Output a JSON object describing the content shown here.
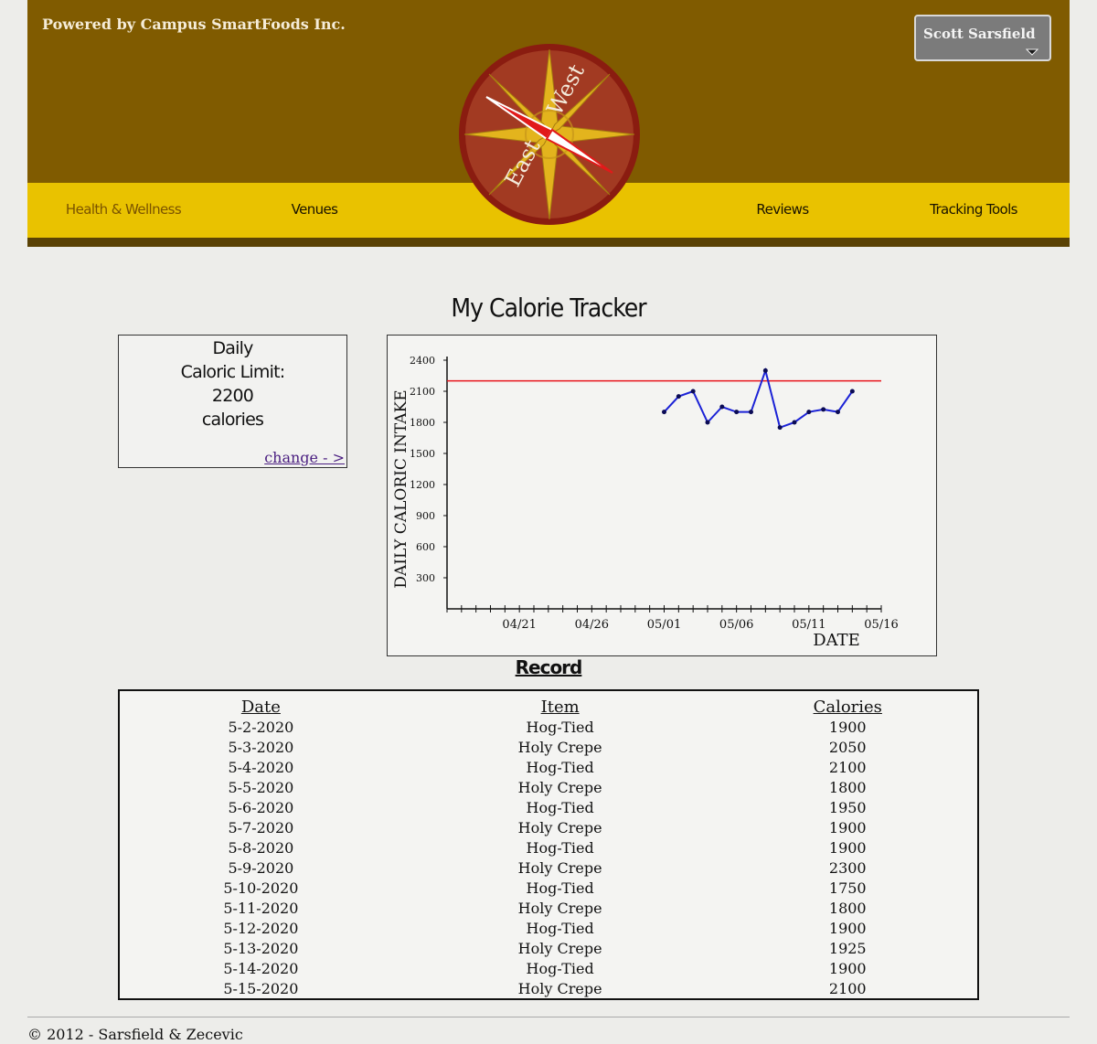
{
  "header": {
    "powered_by": "Powered by Campus SmartFoods Inc.",
    "user_name": "Scott Sarsfield",
    "logo_text_left": "East",
    "logo_text_right": "West",
    "colors": {
      "header_bg": "#805b00",
      "nav_bg": "#e9c200",
      "nav_border": "#5a4205"
    }
  },
  "nav": {
    "items": [
      {
        "label": "Health & Wellness",
        "active": true
      },
      {
        "label": "Venues",
        "active": false
      },
      {
        "label": "Reviews",
        "active": false
      },
      {
        "label": "Tracking Tools",
        "active": false
      }
    ]
  },
  "page": {
    "title": "My Calorie Tracker"
  },
  "limit": {
    "line1": "Daily",
    "line2": "Caloric Limit:",
    "value": "2200",
    "unit": "calories",
    "change_link": "change - >"
  },
  "chart_data": {
    "type": "line",
    "xlabel": "DATE",
    "ylabel": "DAILY CALORIC INTAKE",
    "ylim": [
      0,
      2400
    ],
    "yticks": [
      300,
      600,
      900,
      1200,
      1500,
      1800,
      2100,
      2400
    ],
    "xtick_labels": [
      "04/21",
      "04/26",
      "05/01",
      "05/06",
      "05/11",
      "05/16"
    ],
    "x_range": [
      "04/16",
      "05/16"
    ],
    "limit_line": 2200,
    "limit_color": "#e8141c",
    "series": [
      {
        "color": "#1b22d6",
        "points": [
          {
            "x": "05/01",
            "y": 1900
          },
          {
            "x": "05/02",
            "y": 2050
          },
          {
            "x": "05/03",
            "y": 2100
          },
          {
            "x": "05/04",
            "y": 1800
          },
          {
            "x": "05/05",
            "y": 1950
          },
          {
            "x": "05/06",
            "y": 1900
          },
          {
            "x": "05/07",
            "y": 1900
          },
          {
            "x": "05/08",
            "y": 2300
          },
          {
            "x": "05/09",
            "y": 1750
          },
          {
            "x": "05/10",
            "y": 1800
          },
          {
            "x": "05/11",
            "y": 1900
          },
          {
            "x": "05/12",
            "y": 1925
          },
          {
            "x": "05/13",
            "y": 1900
          },
          {
            "x": "05/14",
            "y": 2100
          }
        ]
      }
    ]
  },
  "record": {
    "title": "Record",
    "headers": [
      "Date",
      "Item",
      "Calories"
    ],
    "rows": [
      [
        "5-2-2020",
        "Hog-Tied",
        "1900"
      ],
      [
        "5-3-2020",
        "Holy Crepe",
        "2050"
      ],
      [
        "5-4-2020",
        "Hog-Tied",
        "2100"
      ],
      [
        "5-5-2020",
        "Holy Crepe",
        "1800"
      ],
      [
        "5-6-2020",
        "Hog-Tied",
        "1950"
      ],
      [
        "5-7-2020",
        "Holy Crepe",
        "1900"
      ],
      [
        "5-8-2020",
        "Hog-Tied",
        "1900"
      ],
      [
        "5-9-2020",
        "Holy Crepe",
        "2300"
      ],
      [
        "5-10-2020",
        "Hog-Tied",
        "1750"
      ],
      [
        "5-11-2020",
        "Holy Crepe",
        "1800"
      ],
      [
        "5-12-2020",
        "Hog-Tied",
        "1900"
      ],
      [
        "5-13-2020",
        "Holy Crepe",
        "1925"
      ],
      [
        "5-14-2020",
        "Hog-Tied",
        "1900"
      ],
      [
        "5-15-2020",
        "Holy Crepe",
        "2100"
      ]
    ]
  },
  "footer": {
    "text": "© 2012 - Sarsfield & Zecevic"
  }
}
